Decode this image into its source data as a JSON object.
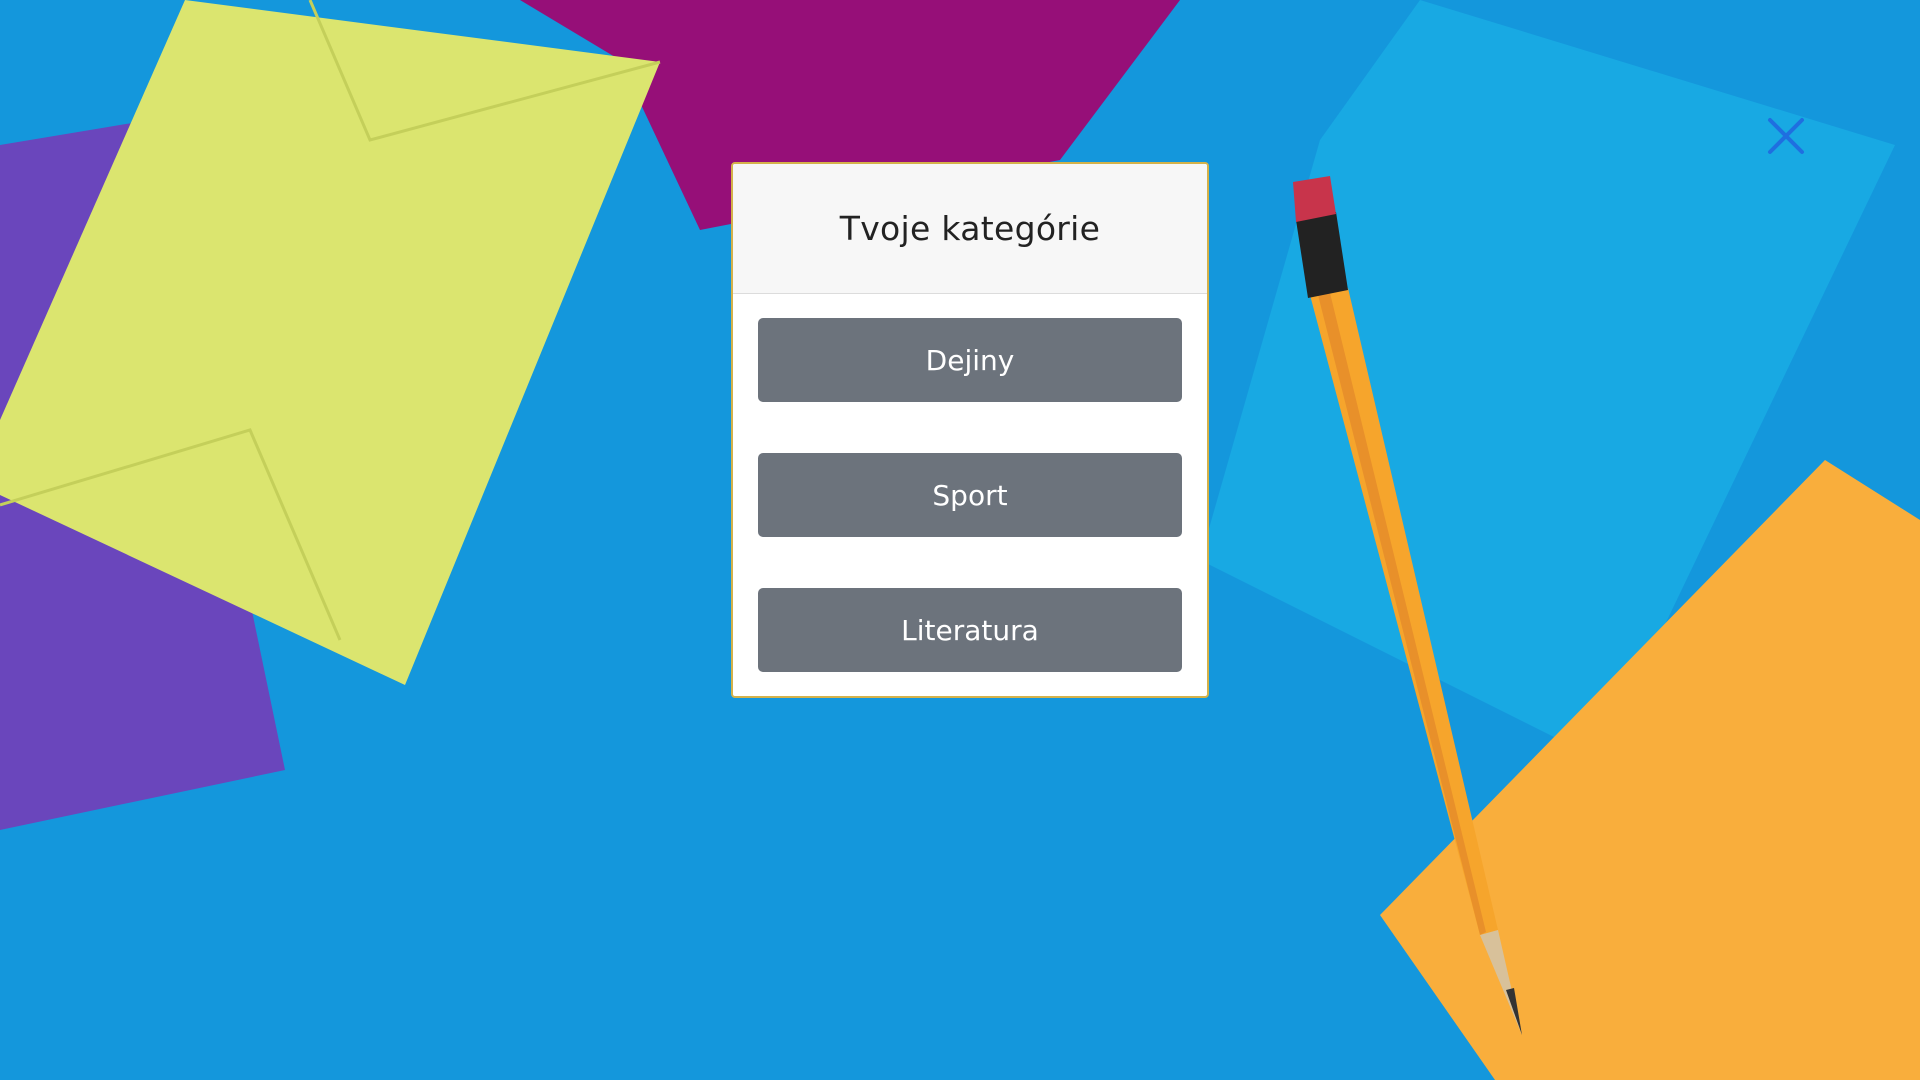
{
  "panel": {
    "title": "Tvoje kategórie",
    "categories": [
      {
        "label": "Dejiny"
      },
      {
        "label": "Sport"
      },
      {
        "label": "Literatura"
      }
    ]
  },
  "close_icon": "close-icon",
  "colors": {
    "background": "#1497dc",
    "button": "#6c737c",
    "close_icon": "#1f6fe0",
    "panel_border": "#d4b24a"
  }
}
